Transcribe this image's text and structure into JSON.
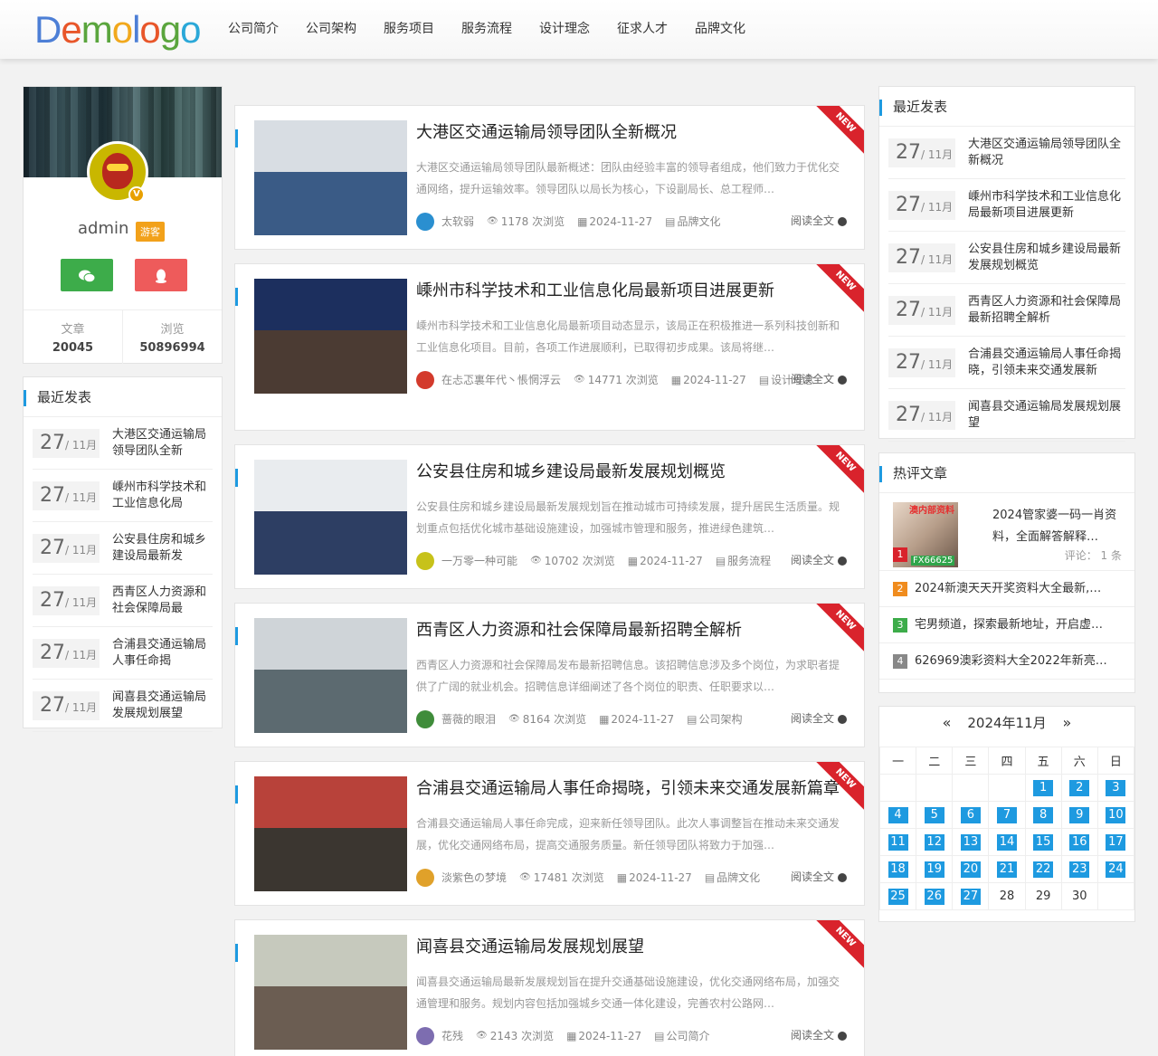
{
  "header": {
    "logo_letters": [
      "D",
      "e",
      "m",
      "o",
      "l",
      "o",
      "g",
      "o"
    ],
    "logo_colors": [
      "#4d7fd6",
      "#e8562a",
      "#5aa53d",
      "#f1a81c",
      "#4d7fd6",
      "#e8562a",
      "#5aa53d",
      "#2ba8d8"
    ],
    "nav": [
      "公司简介",
      "公司架构",
      "服务项目",
      "服务流程",
      "设计理念",
      "征求人才",
      "品牌文化"
    ]
  },
  "profile": {
    "username": "admin",
    "role": "游客",
    "verified_badge": "V",
    "wechat_icon": "wechat-icon",
    "qq_icon": "qq-icon",
    "stats": [
      {
        "label": "文章",
        "value": "20045"
      },
      {
        "label": "浏览",
        "value": "50896994"
      }
    ]
  },
  "left_recent": {
    "title": "最近发表",
    "items": [
      {
        "day": "27",
        "month": "/ 11月",
        "title": "大港区交通运输局领导团队全新"
      },
      {
        "day": "27",
        "month": "/ 11月",
        "title": "嵊州市科学技术和工业信息化局"
      },
      {
        "day": "27",
        "month": "/ 11月",
        "title": "公安县住房和城乡建设局最新发"
      },
      {
        "day": "27",
        "month": "/ 11月",
        "title": "西青区人力资源和社会保障局最"
      },
      {
        "day": "27",
        "month": "/ 11月",
        "title": "合浦县交通运输局人事任命揭"
      },
      {
        "day": "27",
        "month": "/ 11月",
        "title": "闻喜县交通运输局发展规划展望"
      }
    ]
  },
  "articles": [
    {
      "title": "大港区交通运输局领导团队全新概况",
      "summary": "大港区交通运输局领导团队最新概述：团队由经验丰富的领导者组成，他们致力于优化交通网络，提升运输效率。领导团队以局长为核心，下设副局长、总工程师…",
      "author": "太软弱",
      "views": "1178 次浏览",
      "date": "2024-11-27",
      "category": "品牌文化",
      "read_more": "阅读全文",
      "badge": "NEW",
      "thumb_top": "#d8dde3",
      "thumb_bottom": "#3a5b86",
      "avatar_color": "#2a8fd0"
    },
    {
      "title": "嵊州市科学技术和工业信息化局最新项目进展更新",
      "summary": "嵊州市科学技术和工业信息化局最新项目动态显示，该局正在积极推进一系列科技创新和工业信息化项目。目前，各项工作进展顺利，已取得初步成果。该局将继…",
      "author": "在忐忑裏年代丶悵惘浮云",
      "views": "14771 次浏览",
      "date": "2024-11-27",
      "category": "设计理念",
      "read_more": "阅读全文",
      "badge": "NEW",
      "thumb_top": "#1c2f5e",
      "thumb_bottom": "#4b3b33",
      "avatar_color": "#d33a2c"
    },
    {
      "title": "公安县住房和城乡建设局最新发展规划概览",
      "summary": "公安县住房和城乡建设局最新发展规划旨在推动城市可持续发展，提升居民生活质量。规划重点包括优化城市基础设施建设，加强城市管理和服务，推进绿色建筑…",
      "author": "一万零一种可能",
      "views": "10702 次浏览",
      "date": "2024-11-27",
      "category": "服务流程",
      "read_more": "阅读全文",
      "badge": "NEW",
      "thumb_top": "#e9ecef",
      "thumb_bottom": "#2d3e63",
      "avatar_color": "#c7c21a"
    },
    {
      "title": "西青区人力资源和社会保障局最新招聘全解析",
      "summary": "西青区人力资源和社会保障局发布最新招聘信息。该招聘信息涉及多个岗位，为求职者提供了广阔的就业机会。招聘信息详细阐述了各个岗位的职责、任职要求以…",
      "author": "蔷薇的眼泪",
      "views": "8164 次浏览",
      "date": "2024-11-27",
      "category": "公司架构",
      "read_more": "阅读全文",
      "badge": "NEW",
      "thumb_top": "#cfd4d8",
      "thumb_bottom": "#5c6a70",
      "avatar_color": "#3f8c3a"
    },
    {
      "title": "合浦县交通运输局人事任命揭晓，引领未来交通发展新篇章",
      "summary": "合浦县交通运输局人事任命完成，迎来新任领导团队。此次人事调整旨在推动未来交通发展，优化交通网络布局，提高交通服务质量。新任领导团队将致力于加强…",
      "author": "淡紫色の梦境",
      "views": "17481 次浏览",
      "date": "2024-11-27",
      "category": "品牌文化",
      "read_more": "阅读全文",
      "badge": "NEW",
      "thumb_top": "#b8423a",
      "thumb_bottom": "#3b3630",
      "avatar_color": "#e0a12a"
    },
    {
      "title": "闻喜县交通运输局发展规划展望",
      "summary": "闻喜县交通运输局最新发展规划旨在提升交通基础设施建设，优化交通网络布局，加强交通管理和服务。规划内容包括加强城乡交通一体化建设，完善农村公路网…",
      "author": "花残",
      "views": "2143 次浏览",
      "date": "2024-11-27",
      "category": "公司简介",
      "read_more": "阅读全文",
      "badge": "NEW",
      "thumb_top": "#c6c9bd",
      "thumb_bottom": "#6b5d52",
      "avatar_color": "#7d6db0"
    }
  ],
  "right_recent": {
    "title": "最近发表",
    "items": [
      {
        "day": "27",
        "month": "/ 11月",
        "title": "大港区交通运输局领导团队全新概况"
      },
      {
        "day": "27",
        "month": "/ 11月",
        "title": "嵊州市科学技术和工业信息化局最新项目进展更新"
      },
      {
        "day": "27",
        "month": "/ 11月",
        "title": "公安县住房和城乡建设局最新发展规划概览"
      },
      {
        "day": "27",
        "month": "/ 11月",
        "title": "西青区人力资源和社会保障局最新招聘全解析"
      },
      {
        "day": "27",
        "month": "/ 11月",
        "title": "合浦县交通运输局人事任命揭晓，引领未来交通发展新"
      },
      {
        "day": "27",
        "month": "/ 11月",
        "title": "闻喜县交通运输局发展规划展望"
      }
    ]
  },
  "hot": {
    "title": "热评文章",
    "first": {
      "rank": "1",
      "image_tag": "澳内部资料",
      "image_tag2": "FX66625",
      "title": "2024管家婆一码一肖资料，全面解答解释…",
      "comment": "评论：  1 条"
    },
    "rows": [
      {
        "rank": "2",
        "color": "#f08c1e",
        "title": "2024新澳天天开奖资料大全最新,…"
      },
      {
        "rank": "3",
        "color": "#3dac4a",
        "title": "宅男频道，探索最新地址，开启虚…"
      },
      {
        "rank": "4",
        "color": "#888888",
        "title": "626969澳彩资料大全2022年新亮…"
      }
    ]
  },
  "calendar": {
    "prev": "«",
    "next": "»",
    "month_label": "2024年11月",
    "weekdays": [
      "一",
      "二",
      "三",
      "四",
      "五",
      "六",
      "日"
    ],
    "weeks": [
      [
        "",
        "",
        "",
        "",
        "1",
        "2",
        "3"
      ],
      [
        "4",
        "5",
        "6",
        "7",
        "8",
        "9",
        "10"
      ],
      [
        "11",
        "12",
        "13",
        "14",
        "15",
        "16",
        "17"
      ],
      [
        "18",
        "19",
        "20",
        "21",
        "22",
        "23",
        "24"
      ],
      [
        "25",
        "26",
        "27",
        "28",
        "29",
        "30",
        ""
      ]
    ],
    "highlight_through": 27
  }
}
